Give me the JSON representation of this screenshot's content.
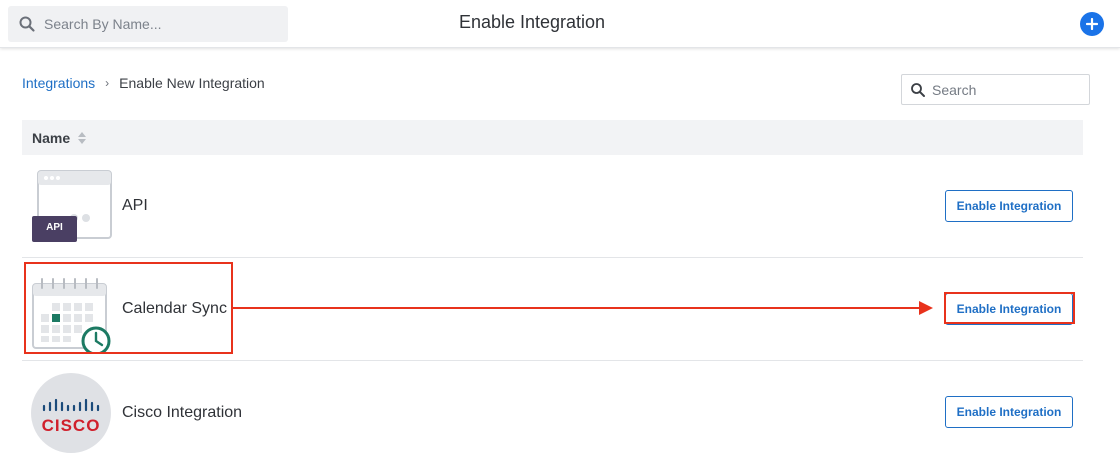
{
  "topbar": {
    "search_placeholder": "Search By Name...",
    "title": "Enable Integration",
    "add_icon": "plus-icon"
  },
  "breadcrumb": {
    "parent": "Integrations",
    "separator": "›",
    "current": "Enable New Integration"
  },
  "table_search": {
    "placeholder": "Search"
  },
  "table": {
    "column_header": "Name",
    "rows": [
      {
        "name": "API",
        "icon": "api-window-icon",
        "button_label": "Enable Integration"
      },
      {
        "name": "Calendar Sync",
        "icon": "calendar-clock-icon",
        "button_label": "Enable Integration"
      },
      {
        "name": "Cisco Integration",
        "icon": "cisco-logo",
        "button_label": "Enable Integration"
      }
    ]
  },
  "api_icon_label": "API",
  "cisco_logo_text": "CISCO",
  "colors": {
    "accent": "#1f6fc5",
    "add_button": "#1a73e8",
    "annotation": "#e8321c",
    "api_badge": "#4a3f63",
    "calendar_highlight": "#1c7a63",
    "cisco_red": "#d0202c",
    "cisco_bars": "#1a4a7a"
  }
}
